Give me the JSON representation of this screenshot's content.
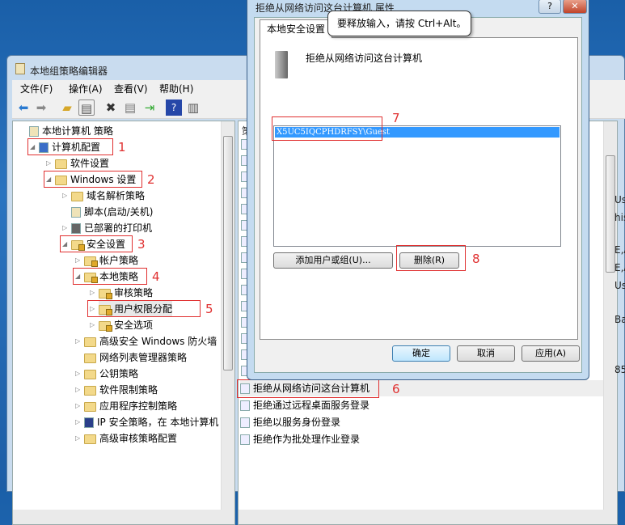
{
  "main_window": {
    "title": "本地组策略编辑器",
    "menu": [
      "文件(F)",
      "操作(A)",
      "查看(V)",
      "帮助(H)"
    ],
    "tree": [
      {
        "label": "本地计算机 策略",
        "level": 0,
        "arrow": "",
        "icon": "doc"
      },
      {
        "label": "计算机配置",
        "level": 1,
        "arrow": "open",
        "icon": "computer",
        "mark": "1"
      },
      {
        "label": "软件设置",
        "level": 2,
        "arrow": "closed",
        "icon": "folder"
      },
      {
        "label": "Windows 设置",
        "level": 2,
        "arrow": "open",
        "icon": "folder",
        "mark": "2"
      },
      {
        "label": "域名解析策略",
        "level": 3,
        "arrow": "closed",
        "icon": "folder"
      },
      {
        "label": "脚本(启动/关机)",
        "level": 3,
        "arrow": "",
        "icon": "doc"
      },
      {
        "label": "已部署的打印机",
        "level": 3,
        "arrow": "closed",
        "icon": "printer"
      },
      {
        "label": "安全设置",
        "level": 3,
        "arrow": "open",
        "icon": "lockfolder",
        "mark": "3"
      },
      {
        "label": "帐户策略",
        "level": 4,
        "arrow": "closed",
        "icon": "lockfolder"
      },
      {
        "label": "本地策略",
        "level": 4,
        "arrow": "open",
        "icon": "lockfolder",
        "mark": "4"
      },
      {
        "label": "审核策略",
        "level": 5,
        "arrow": "closed",
        "icon": "lockfolder"
      },
      {
        "label": "用户权限分配",
        "level": 5,
        "arrow": "closed",
        "icon": "lockfolder",
        "mark": "5"
      },
      {
        "label": "安全选项",
        "level": 5,
        "arrow": "closed",
        "icon": "lockfolder"
      },
      {
        "label": "高级安全 Windows 防火墙",
        "level": 4,
        "arrow": "closed",
        "icon": "folder"
      },
      {
        "label": "网络列表管理器策略",
        "level": 4,
        "arrow": "",
        "icon": "folder"
      },
      {
        "label": "公钥策略",
        "level": 4,
        "arrow": "closed",
        "icon": "folder"
      },
      {
        "label": "软件限制策略",
        "level": 4,
        "arrow": "closed",
        "icon": "folder"
      },
      {
        "label": "应用程序控制策略",
        "level": 4,
        "arrow": "closed",
        "icon": "folder"
      },
      {
        "label": "IP 安全策略，在 本地计算机",
        "level": 4,
        "arrow": "closed",
        "icon": "ipsec"
      },
      {
        "label": "高级审核策略配置",
        "level": 4,
        "arrow": "closed",
        "icon": "folder"
      }
    ],
    "right_header": "策",
    "right_items": [
      "拒绝从网络访问这台计算机",
      "拒绝通过远程桌面服务登录",
      "拒绝以服务身份登录",
      "拒绝作为批处理作业登录"
    ],
    "right_mark": "6",
    "right_fragments": [
      "Us",
      "his",
      "E,A",
      "E,A",
      "Us",
      "Ba",
      "85"
    ]
  },
  "dialog": {
    "title": "拒绝从网络访问这台计算机 属性",
    "help": "?",
    "close": "✕",
    "tab": "本地安全设置",
    "policy_name": "拒绝从网络访问这台计算机",
    "accounts": [
      "X5UC5IQCPHDRFSY\\Guest"
    ],
    "mark_list": "7",
    "add_button": "添加用户或组(U)...",
    "remove_button": "删除(R)",
    "mark_remove": "8",
    "ok": "确定",
    "cancel": "取消",
    "apply": "应用(A)"
  },
  "tooltip": "要释放输入，请按 Ctrl+Alt。"
}
